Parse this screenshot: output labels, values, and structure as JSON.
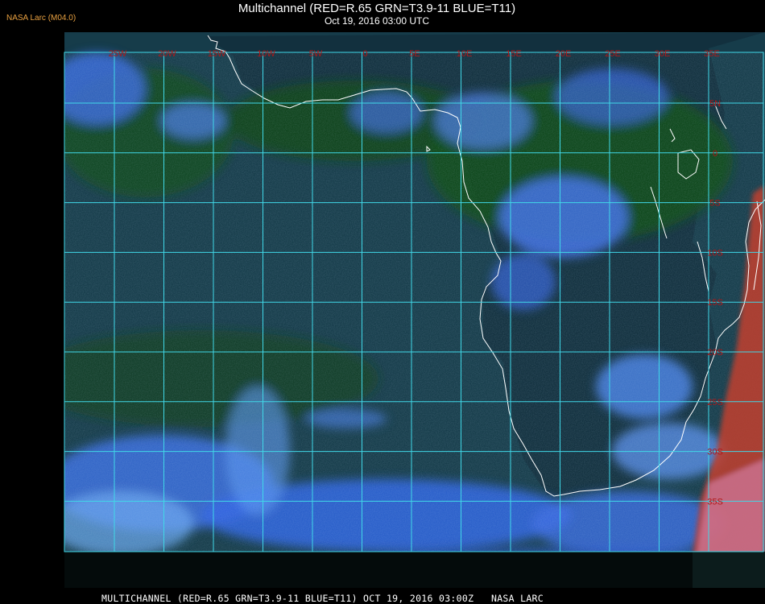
{
  "header": {
    "brand": "NASA Larc (M04.0)",
    "title": "Multichannel (RED=R.65 GRN=T3.9-11 BLUE=T11)",
    "subtitle": "Oct 19, 2016 03:00 UTC"
  },
  "footer": {
    "caption": "MULTICHANNEL (RED=R.65 GRN=T3.9-11 BLUE=T11) OCT 19, 2016 03:00Z   NASA LARC"
  },
  "map": {
    "region": "South Atlantic and Southern Africa",
    "longitude_labels": [
      "25W",
      "20W",
      "15W",
      "10W",
      "5W",
      "0",
      "5E",
      "10E",
      "15E",
      "20E",
      "25E",
      "30E",
      "35E"
    ],
    "latitude_labels": [
      "5N",
      "0",
      "5S",
      "10S",
      "15S",
      "20S",
      "25S",
      "30S",
      "35S"
    ],
    "grid_color": "#40d8e8",
    "label_color": "#b01818",
    "coastline_color": "#ffffff",
    "colors": {
      "ocean": "#163c4a",
      "land_dry": "#12303e",
      "tropical_forest": "#0d4a18",
      "cloud_cold": "#3060e0",
      "cloud_thin": "#6aa8f0",
      "red_band": "#e04028"
    }
  }
}
